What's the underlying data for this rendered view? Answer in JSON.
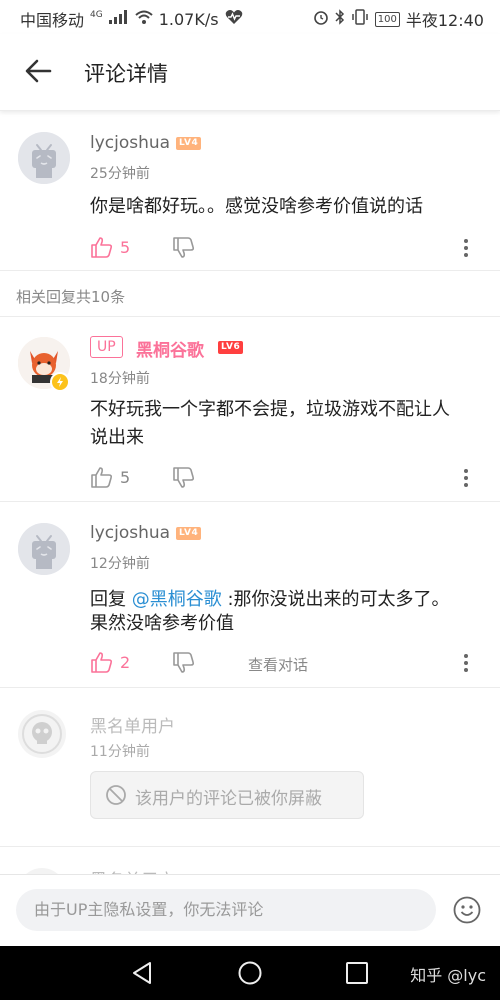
{
  "status_bar": {
    "carrier": "中国移动",
    "network": "4G",
    "speed": "1.07K/s",
    "battery": "100",
    "time": "半夜12:40"
  },
  "header": {
    "title": "评论详情"
  },
  "main_comment": {
    "username": "lycjoshua",
    "level": "LV4",
    "time": "25分钟前",
    "content": "你是啥都好玩。。感觉没啥参考价值说的话",
    "likes": "5"
  },
  "replies_label": "相关回复共10条",
  "replies": [
    {
      "tag": "UP",
      "username": "黑桐谷歌",
      "level": "LV6",
      "time": "18分钟前",
      "content_line1": "不好玩我一个字都不会提，垃圾游戏不配让人",
      "content_line2": "说出来",
      "likes": "5"
    },
    {
      "username": "lycjoshua",
      "level": "LV4",
      "time": "12分钟前",
      "reply_prefix": "回复",
      "mention": "@黑桐谷歌",
      "content_rest": ":那你没说出来的可太多了。",
      "content_line2": "果然没啥参考价值",
      "likes": "2",
      "view_conversation": "查看对话"
    },
    {
      "username": "黑名单用户",
      "time": "11分钟前",
      "blocked_text": "该用户的评论已被你屏蔽"
    },
    {
      "username": "黑名单用户"
    }
  ],
  "input_bar": {
    "placeholder": "由于UP主隐私设置，你无法评论"
  },
  "watermark": "知乎 @lyc",
  "colors": {
    "pink": "#fb7299",
    "mention_blue": "#2b8fd3",
    "lv4": "#ffb37c",
    "lv6": "#ff3f3f"
  }
}
